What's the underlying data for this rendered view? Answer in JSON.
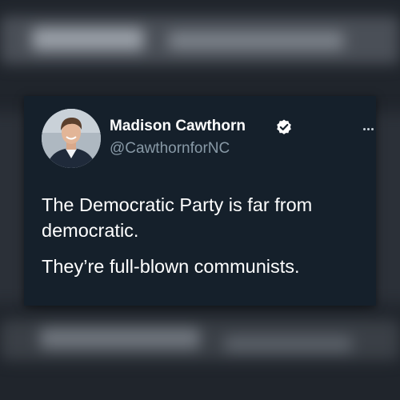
{
  "tweet": {
    "display_name": "Madison Cawthorn",
    "handle": "@CawthornforNC",
    "verified_icon": "verified-badge-icon",
    "more_icon": "more-options-icon",
    "text_paragraphs": [
      "The Democratic Party is far from democratic.",
      "They’re full-blown communists."
    ],
    "colors": {
      "card_background": "#15202b",
      "text": "#ffffff",
      "handle": "#8899a6"
    }
  }
}
